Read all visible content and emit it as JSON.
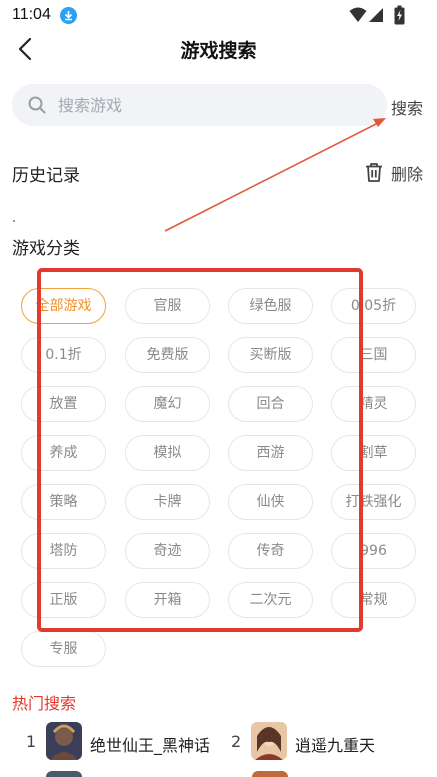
{
  "status_bar": {
    "time": "11:04"
  },
  "header": {
    "title": "游戏搜索"
  },
  "search": {
    "placeholder": "搜索游戏",
    "value": "",
    "button_label": "搜索"
  },
  "history": {
    "title": "历史记录",
    "delete_label": "删除"
  },
  "categories": {
    "title": "游戏分类",
    "active_index": 0,
    "items": [
      "全部游戏",
      "官服",
      "绿色服",
      "0.05折",
      "0.1折",
      "免费版",
      "买断版",
      "三国",
      "放置",
      "魔幻",
      "回合",
      "精灵",
      "养成",
      "模拟",
      "西游",
      "割草",
      "策略",
      "卡牌",
      "仙侠",
      "打铁强化",
      "塔防",
      "奇迹",
      "传奇",
      "996",
      "正版",
      "开箱",
      "二次元",
      "常规",
      "专服"
    ]
  },
  "hot_search": {
    "title": "热门搜索",
    "items": [
      {
        "rank": "1",
        "name": "绝世仙王_黑神话"
      },
      {
        "rank": "2",
        "name": "逍遥九重天"
      }
    ]
  },
  "colors": {
    "accent_orange": "#f0932a",
    "highlight_red": "#e23a2e",
    "hot_red": "#e5382b",
    "download_blue": "#2aa1f2"
  },
  "icons": [
    "download-icon",
    "wifi-icon",
    "signal-icon",
    "battery-icon",
    "back-icon",
    "search-icon",
    "trash-icon"
  ]
}
